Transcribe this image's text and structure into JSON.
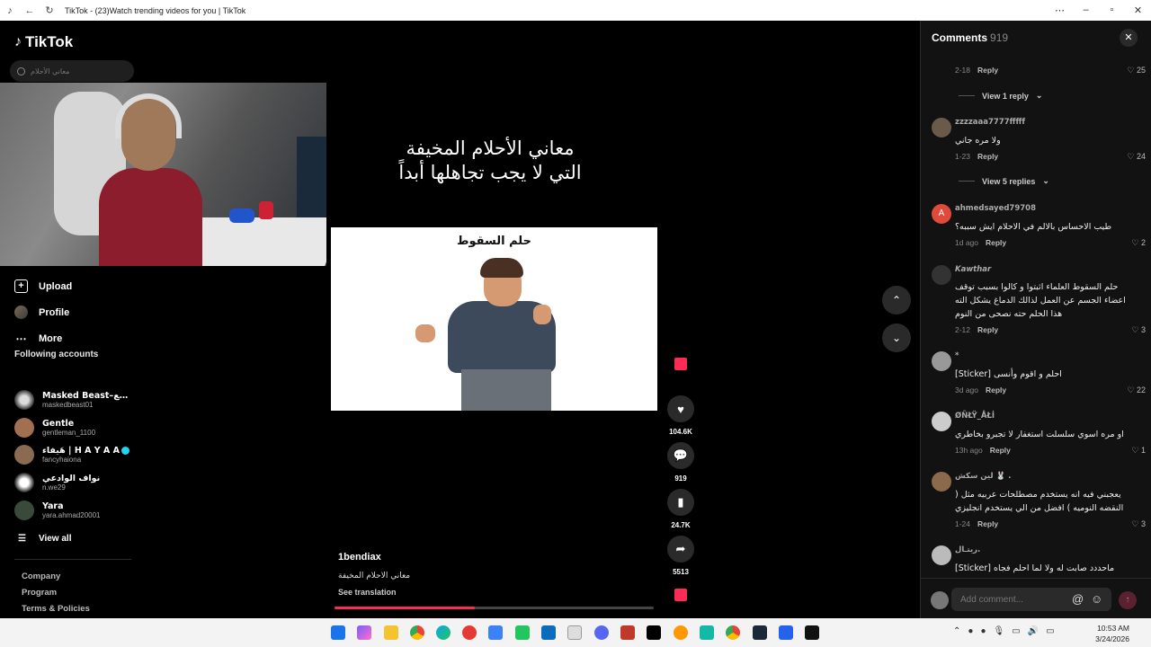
{
  "window": {
    "title": "TikTok - (23)Watch trending videos for you | TikTok"
  },
  "sidebar": {
    "logo": "TikTok",
    "search_placeholder": "معاني الأحلام",
    "nav": [
      {
        "label": "Upload",
        "icon": "upload-icon"
      },
      {
        "label": "Profile",
        "icon": "profile-icon"
      },
      {
        "label": "More",
        "icon": "more-icon"
      }
    ],
    "following_header": "Following accounts",
    "accounts": [
      {
        "name": "Masked Beast–مقنع...",
        "username": "maskedbeast01"
      },
      {
        "name": "Gentle",
        "username": "gentleman_1100"
      },
      {
        "name": "هَيفاء | H A Y A A",
        "username": "fancyhaiona",
        "verified": true
      },
      {
        "name": "نواف الوادعي",
        "username": "n.we29"
      },
      {
        "name": "Yara",
        "username": "yara.ahmad20001"
      }
    ],
    "view_all": "View all",
    "footer_links": [
      "Company",
      "Program",
      "Terms & Policies"
    ]
  },
  "video": {
    "title_line1": "معاني الأحلام المخيفة",
    "title_line2": "التي لا يجب تجاهلها أبداً",
    "image_caption": "حلم السقوط",
    "author": "1bendiax",
    "description": "معاني الاحلام المخيفة",
    "see_translation": "See translation",
    "progress": 0.44
  },
  "actions": {
    "likes": "104.6K",
    "comments": "919",
    "saves": "24.7K",
    "shares": "5513"
  },
  "comments_panel": {
    "title": "Comments",
    "count": "919",
    "items": [
      {
        "user": "",
        "text": "",
        "date": "2-18",
        "reply": "Reply",
        "likes": "25",
        "view_replies": "View 1 reply"
      },
      {
        "user": "zzzzaaa7777fffff",
        "text": "ولا مره جاني",
        "date": "1-23",
        "reply": "Reply",
        "likes": "24",
        "view_replies": "View 5 replies"
      },
      {
        "user": "ahmedsayed79708",
        "text": "طيب الاحساس بالالم في الاحلام ايش سببه؟",
        "date": "1d ago",
        "reply": "Reply",
        "likes": "2"
      },
      {
        "user": "Kawthar",
        "text": "حلم السقوط العلماء اثبتوا و كالوا بسبب توقف اعضاء الجسم عن العمل لذالك الدماغ يشكل الته هذا الحلم حته نصحى من النوم",
        "date": "2-12",
        "reply": "Reply",
        "likes": "3"
      },
      {
        "user": "*",
        "text": "[Sticker] احلم و اقوم وأنسى",
        "date": "3d ago",
        "reply": "Reply",
        "likes": "22"
      },
      {
        "user": "ØÑŁŸ_ÅŁİ",
        "text": "او مره اسوي سلسلت استغفار لا تجبرو بخاطري",
        "date": "13h ago",
        "reply": "Reply",
        "likes": "1"
      },
      {
        "user": "لين سكش 🐰 .",
        "text": "يعجبني فيه انه يستخدم مصطلحات عربيه مثل ( النقضه النوميه ) افضل من الي يستخدم انجليزي",
        "date": "1-24",
        "reply": "Reply",
        "likes": "3"
      },
      {
        "user": "ريتـال.",
        "text": "[Sticker] ماحددد صابت له ولا لما احلم فجاه",
        "date": "",
        "reply": "",
        "likes": ""
      }
    ],
    "add_placeholder": "Add comment..."
  },
  "taskbar": {
    "time": "10:53 AM",
    "date": "3/24/2026"
  }
}
